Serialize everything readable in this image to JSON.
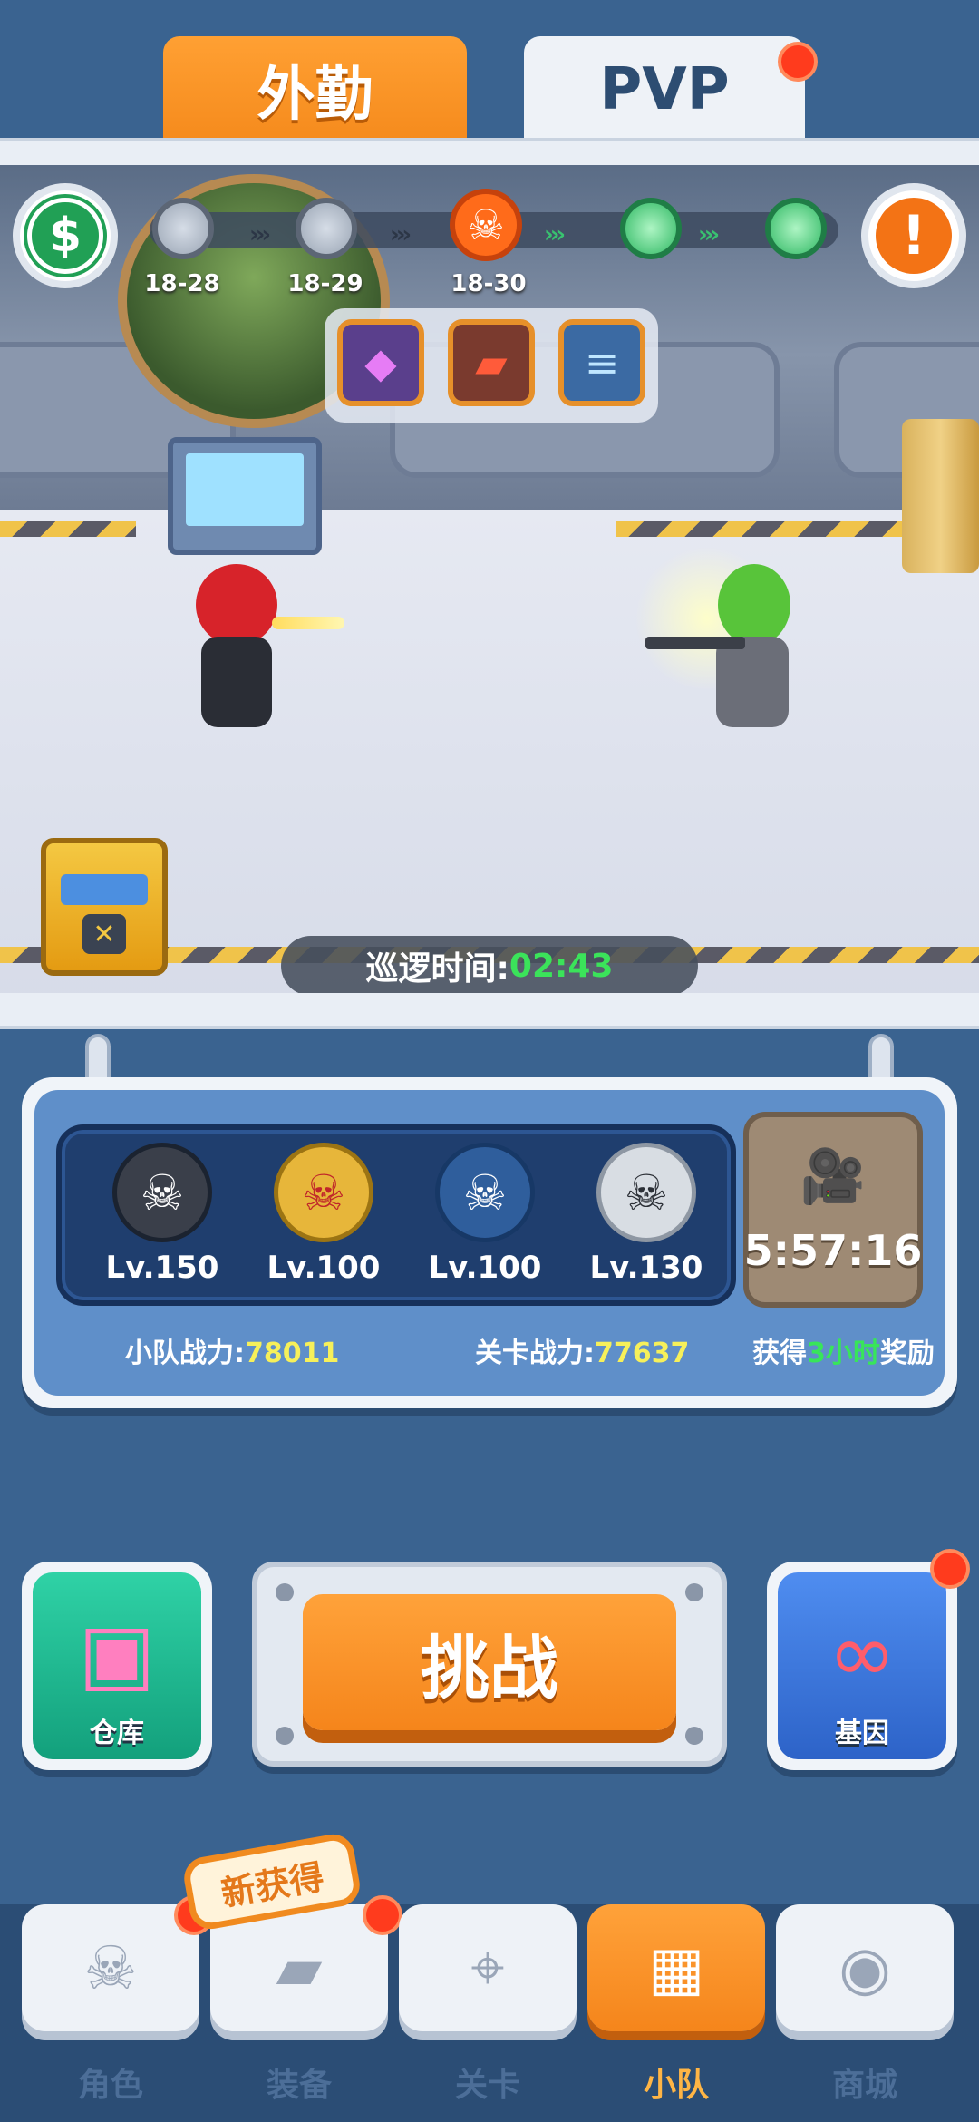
{
  "top_tabs": [
    {
      "label": "外勤",
      "active": true
    },
    {
      "label": "PVP",
      "active": false,
      "notification": true
    }
  ],
  "progress": {
    "stages": [
      {
        "label": "18-28",
        "state": "cleared"
      },
      {
        "label": "18-29",
        "state": "cleared"
      },
      {
        "label": "18-30",
        "state": "boss"
      },
      {
        "label": "",
        "state": "upcoming"
      },
      {
        "label": "",
        "state": "upcoming"
      }
    ],
    "boss_icon": "☠",
    "rewards": [
      "gem-icon",
      "weapon-card-icon",
      "blueprint-icon"
    ]
  },
  "scene": {
    "cash_icon": "$",
    "alert_icon": "!",
    "chest_icon": "✕",
    "patrol_label": "巡逻时间:",
    "patrol_time": "02:43"
  },
  "squad": {
    "members": [
      {
        "level": "Lv.150",
        "icon": "☠",
        "color": "#3a3f4a"
      },
      {
        "level": "Lv.100",
        "icon": "☠",
        "color": "#e7b63a"
      },
      {
        "level": "Lv.100",
        "icon": "☠",
        "color": "#2f5e9c"
      },
      {
        "level": "Lv.130",
        "icon": "☠",
        "color": "#d8dde3"
      }
    ],
    "video_icon": "🎥",
    "video_timer": "5:57:16",
    "squad_power_label": "小队战力:",
    "squad_power_value": "78011",
    "stage_power_label": "关卡战力:",
    "stage_power_value": "77637",
    "reward_prefix": "获得",
    "reward_hours": "3小时",
    "reward_suffix": "奖励"
  },
  "actions": {
    "warehouse_label": "仓库",
    "warehouse_icon": "▣",
    "challenge_label": "挑战",
    "gene_label": "基因",
    "gene_icon": "∞",
    "gene_notification": true
  },
  "new_badge": "新获得",
  "nav": [
    {
      "label": "角色",
      "icon": "☠",
      "active": false,
      "notification": true
    },
    {
      "label": "装备",
      "icon": "▰",
      "active": false,
      "notification": true
    },
    {
      "label": "关卡",
      "icon": "⌖",
      "active": false,
      "notification": false
    },
    {
      "label": "小队",
      "icon": "▦",
      "active": true,
      "notification": false
    },
    {
      "label": "商城",
      "icon": "◉",
      "active": false,
      "notification": false
    }
  ],
  "colors": {
    "accent_orange": "#f5851b",
    "background_blue": "#3a6390",
    "highlight_green": "#3be35a",
    "highlight_yellow": "#f6f05a",
    "notification_red": "#ff3b1d"
  }
}
